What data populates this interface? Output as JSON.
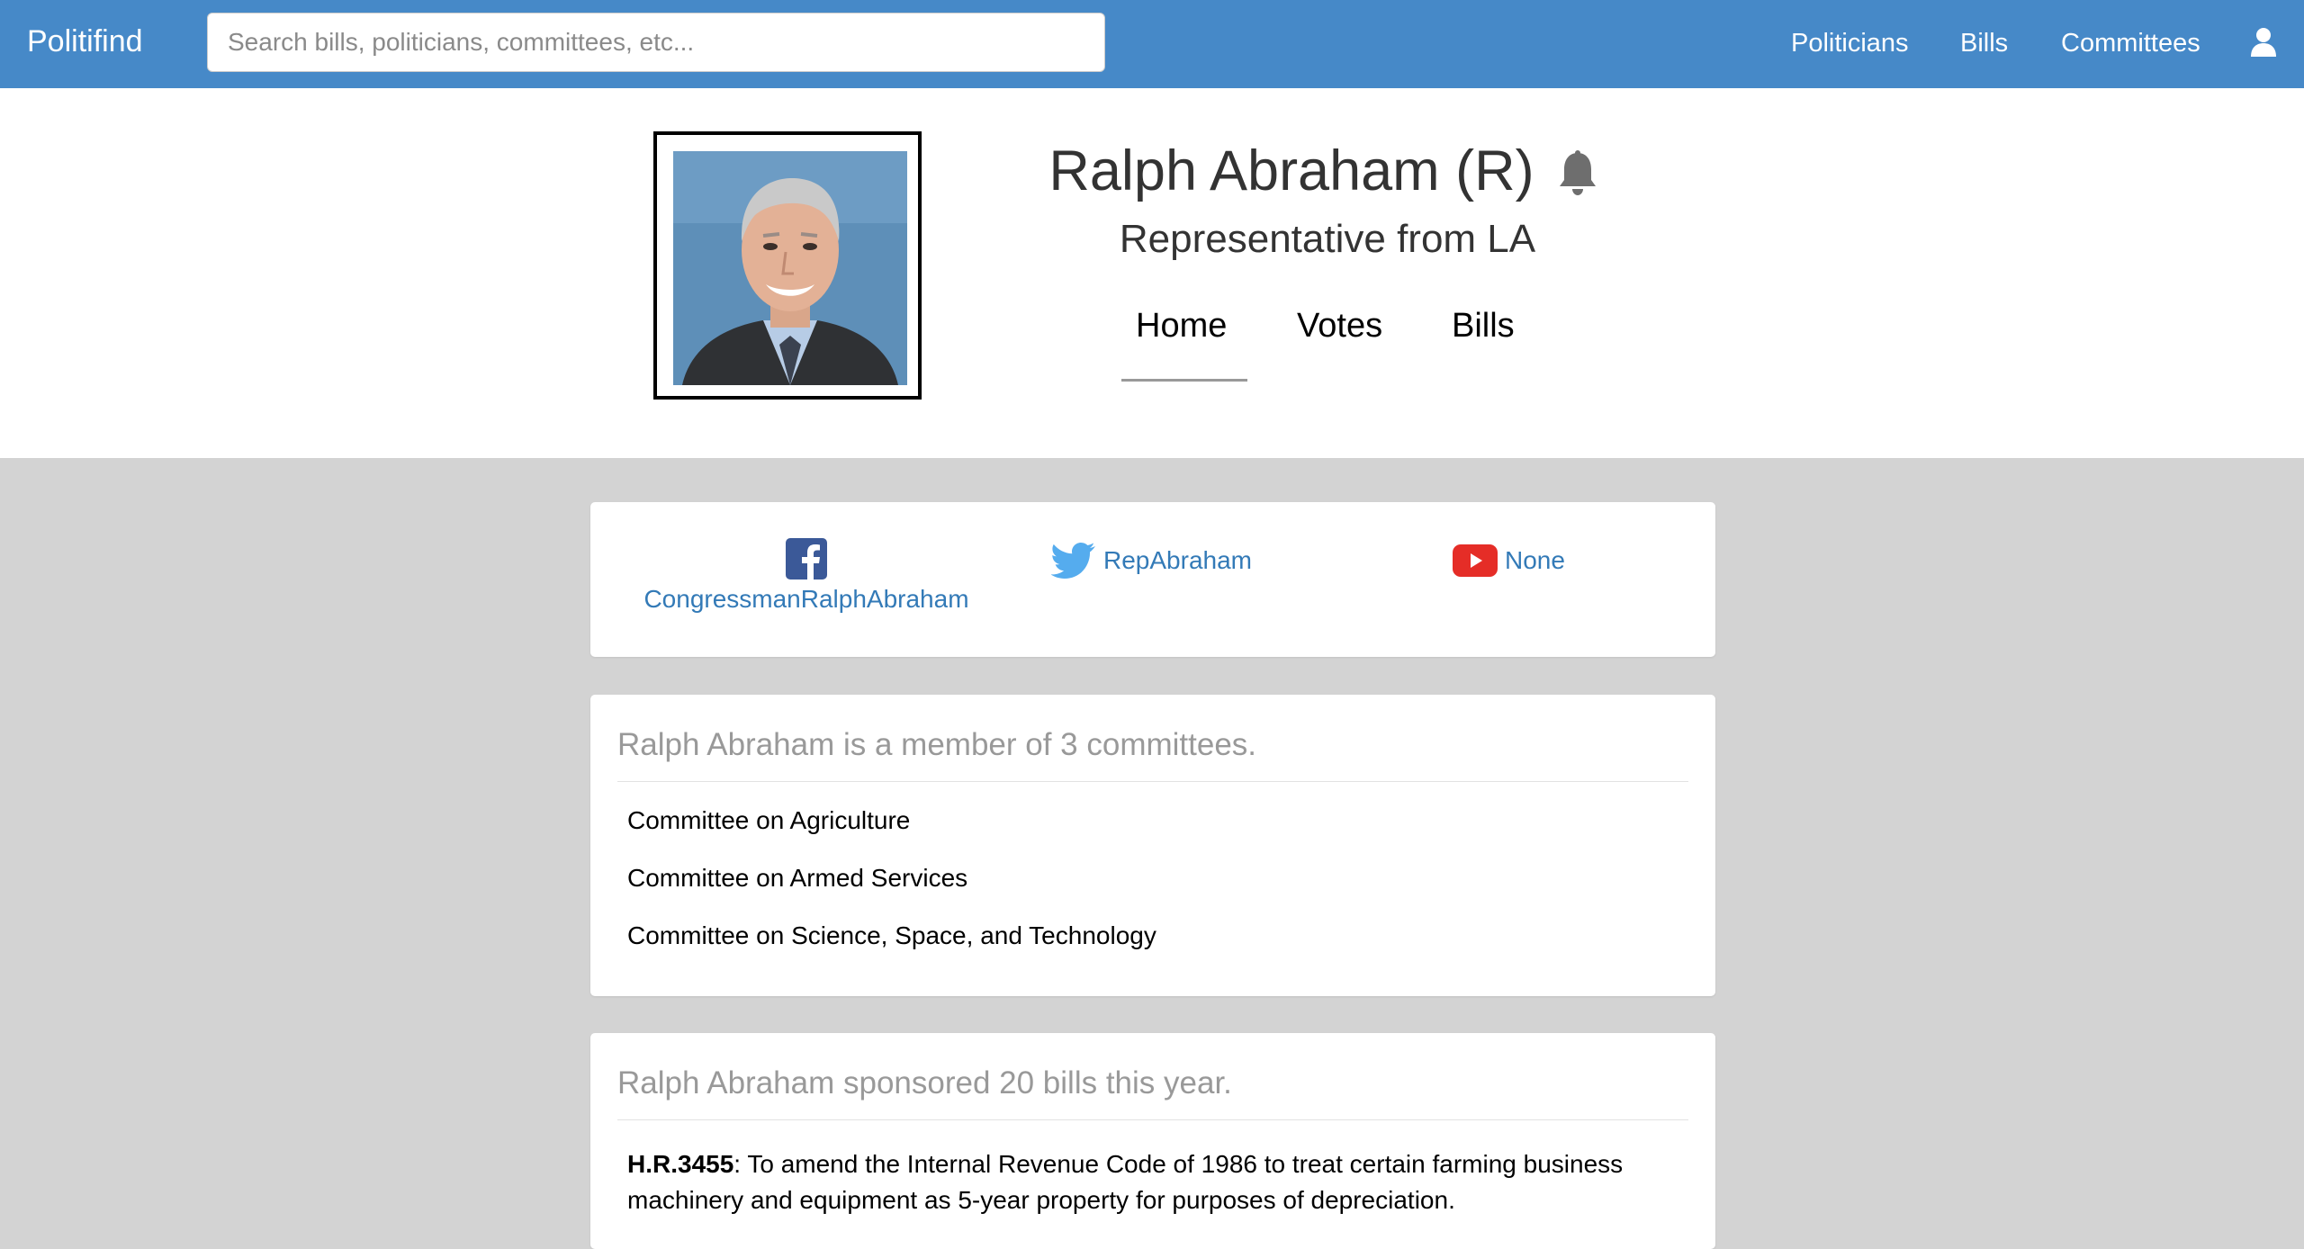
{
  "navbar": {
    "brand": "Politifind",
    "search_placeholder": "Search bills, politicians, committees, etc...",
    "links": [
      "Politicians",
      "Bills",
      "Committees"
    ],
    "user_icon": "user-icon",
    "background": "#4689c8"
  },
  "profile": {
    "name": "Ralph Abraham (R)",
    "role": "Representative from LA",
    "bell_icon": "bell-icon",
    "tabs": [
      "Home",
      "Votes",
      "Bills"
    ],
    "active_tab": "Home"
  },
  "social": {
    "facebook": "CongressmanRalphAbraham",
    "twitter": "RepAbraham",
    "youtube": "None"
  },
  "committees": {
    "heading": "Ralph Abraham is a member of 3 committees.",
    "items": [
      "Committee on Agriculture",
      "Committee on Armed Services",
      "Committee on Science, Space, and Technology"
    ]
  },
  "bills": {
    "heading": "Ralph Abraham sponsored 20 bills this year.",
    "items": [
      {
        "number": "H.R.3455",
        "title": ": To amend the Internal Revenue Code of 1986 to treat certain farming business machinery and equipment as 5-year property for purposes of depreciation."
      }
    ]
  },
  "colors": {
    "link": "#337ab7",
    "page_background": "#d3d3d3",
    "facebook": "#3b5998",
    "twitter": "#55acee",
    "youtube": "#e52d27"
  }
}
